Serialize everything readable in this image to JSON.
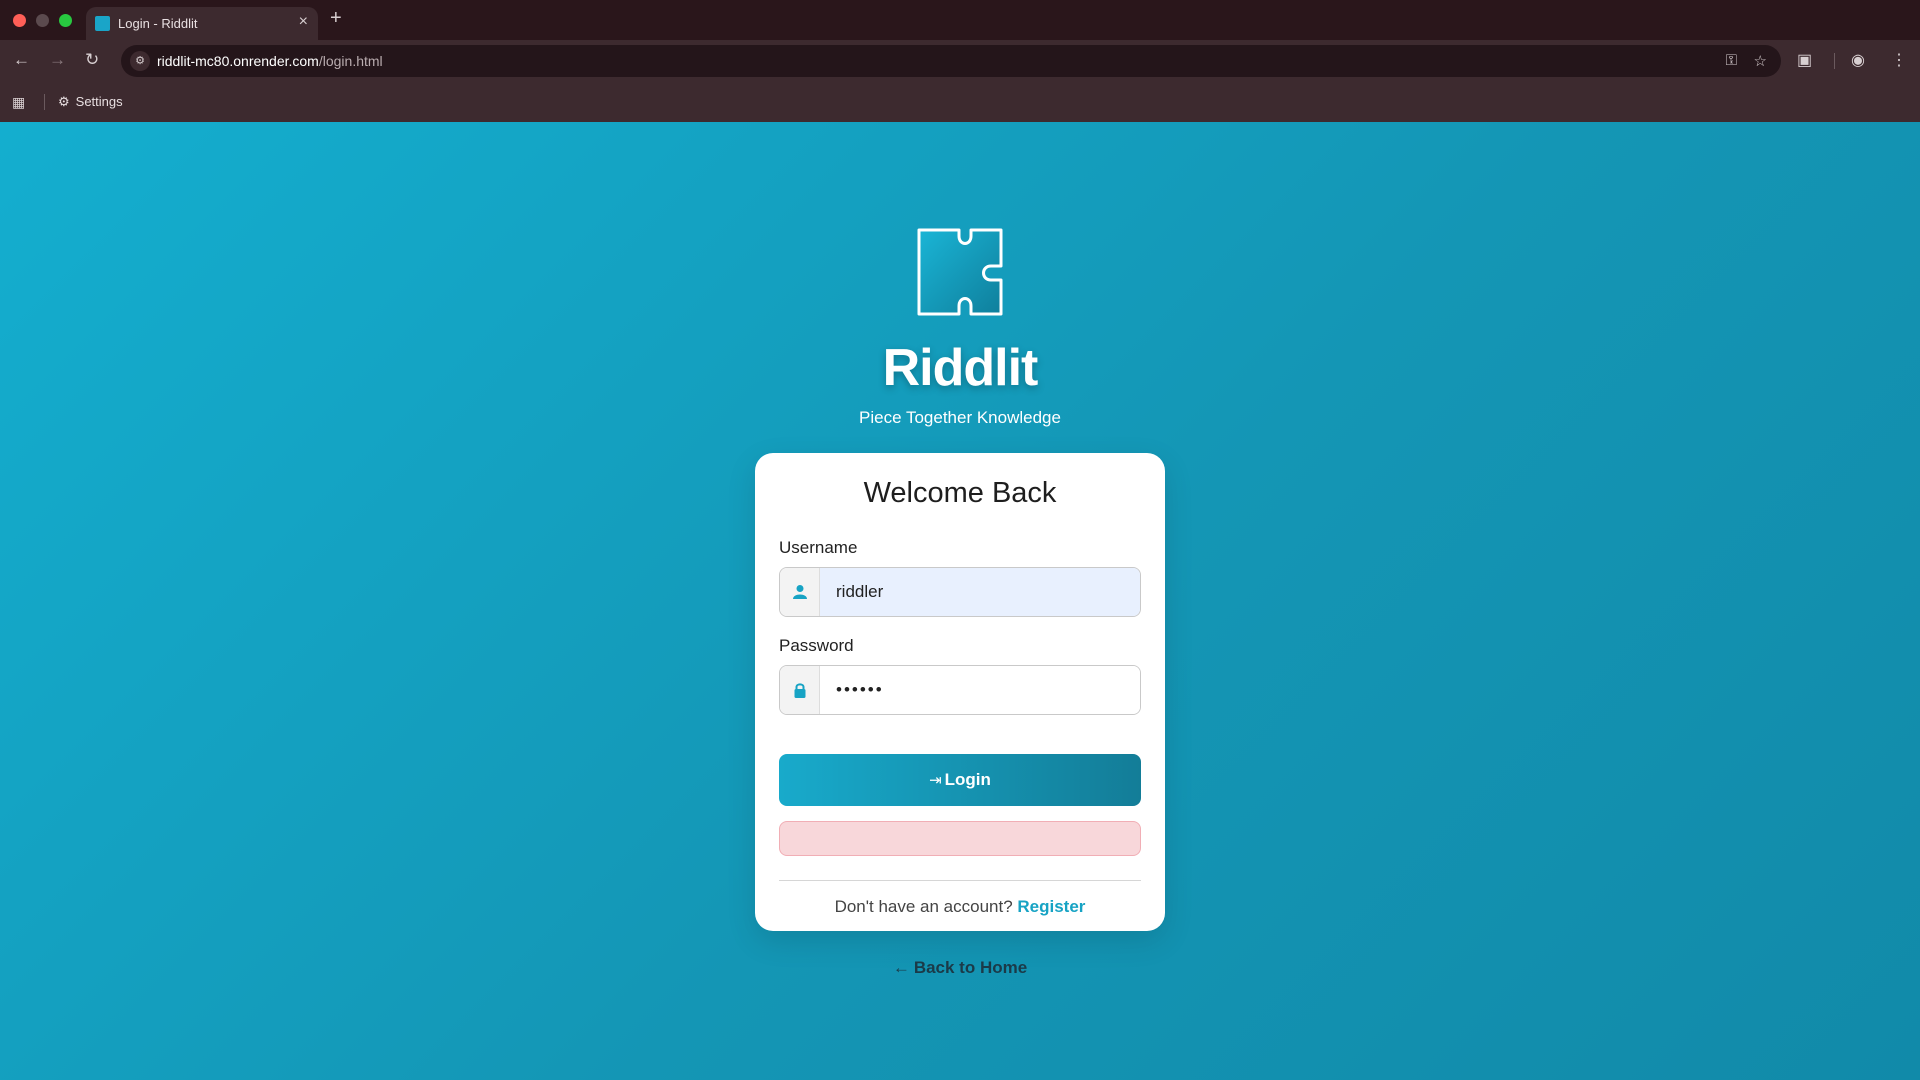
{
  "browser": {
    "tab_title": "Login - Riddlit",
    "url_host": "riddlit-mc80.onrender.com",
    "url_path": "/login.html",
    "bookmark_settings": "Settings"
  },
  "page": {
    "brand": "Riddlit",
    "tagline": "Piece Together Knowledge",
    "card_title": "Welcome Back",
    "username_label": "Username",
    "username_value": "riddler",
    "password_label": "Password",
    "password_value": "••••••",
    "login_label": "Login",
    "register_prompt": "Don't have an account?",
    "register_link": "Register",
    "back_home": "Back to Home"
  },
  "colors": {
    "brand_teal": "#14aecf",
    "error_bg": "#f8d7da"
  },
  "icons": [
    "puzzle-logo-icon",
    "user-icon",
    "lock-icon",
    "login-icon",
    "arrow-left-icon"
  ]
}
